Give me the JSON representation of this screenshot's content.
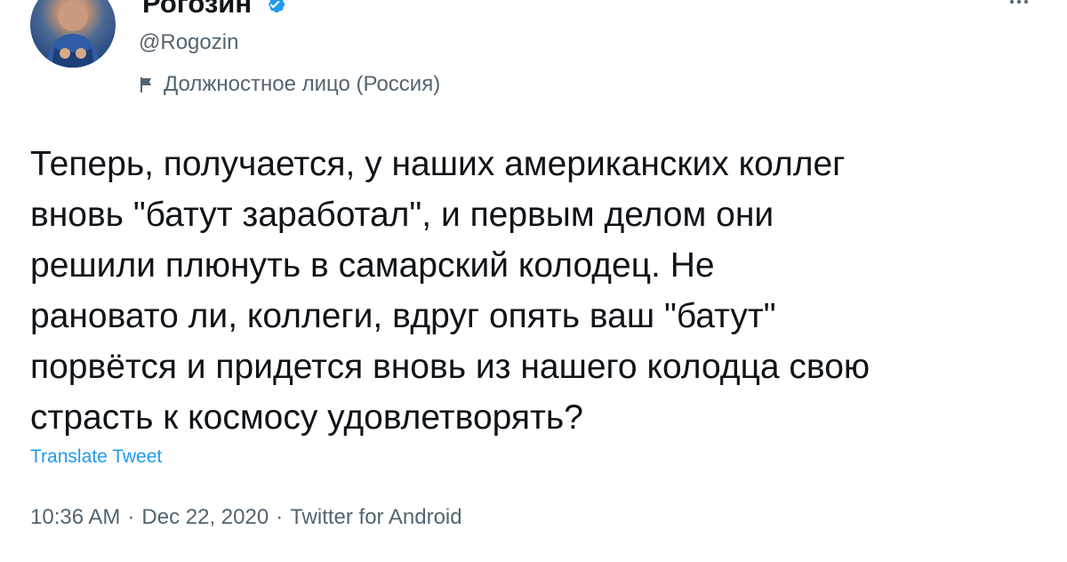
{
  "profile": {
    "display_name": "Рогозин",
    "handle": "@Rogozin",
    "affiliation": "Должностное лицо (Россия)",
    "verified_icon": "verified-check-icon",
    "avatar_icon": "avatar"
  },
  "tweet": {
    "text": "Теперь, получается, у наших американских коллег\nвновь \"батут заработал\", и первым делом они\nрешили плюнуть в самарский колодец. Не\nрановато ли, коллеги, вдруг опять ваш \"батут\"\nпорвётся и придется вновь из нашего колодца свою\nстрасть к космосу удовлетворять?",
    "translate_label": "Translate Tweet",
    "time": "10:36 AM",
    "date": "Dec 22, 2020",
    "source": "Twitter for Android",
    "meta_separator": "·"
  },
  "actions": {
    "more_icon": "more-options-icon"
  },
  "colors": {
    "text": "#0f1419",
    "secondary": "#536471",
    "link": "#1d9bf0",
    "verified": "#1d9bf0",
    "background": "#ffffff"
  }
}
